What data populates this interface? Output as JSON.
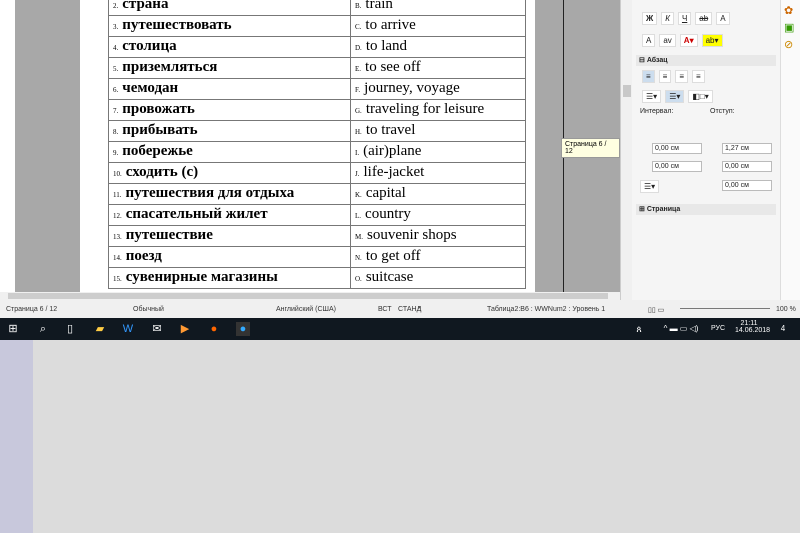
{
  "table": {
    "rows": [
      {
        "num": "2.",
        "ru": "страна",
        "letter": "B.",
        "en": "train"
      },
      {
        "num": "3.",
        "ru": "путешествовать",
        "letter": "C.",
        "en": "to arrive"
      },
      {
        "num": "4.",
        "ru": "столица",
        "letter": "D.",
        "en": "to land"
      },
      {
        "num": "5.",
        "ru": "приземляться",
        "letter": "E.",
        "en": "to see off"
      },
      {
        "num": "6.",
        "ru": "чемодан",
        "letter": "F.",
        "en": "journey, voyage"
      },
      {
        "num": "7.",
        "ru": "провожать",
        "letter": "G.",
        "en": "traveling for leisure"
      },
      {
        "num": "8.",
        "ru": "прибывать",
        "letter": "H.",
        "en": "to travel"
      },
      {
        "num": "9.",
        "ru": "побережье",
        "letter": "I.",
        "en": "(air)plane"
      },
      {
        "num": "10.",
        "ru": "сходить (с)",
        "letter": "J.",
        "en": "life-jacket"
      },
      {
        "num": "11.",
        "ru": "путешествия для отдыха",
        "letter": "K.",
        "en": "capital"
      },
      {
        "num": "12.",
        "ru": "спасательный жилет",
        "letter": "L.",
        "en": "country"
      },
      {
        "num": "13.",
        "ru": "путешествие",
        "letter": "M.",
        "en": "souvenir shops"
      },
      {
        "num": "14.",
        "ru": "поезд",
        "letter": "N.",
        "en": "to get off"
      },
      {
        "num": "15.",
        "ru": "сувенирные магазины",
        "letter": "O.",
        "en": "suitcase"
      }
    ]
  },
  "tooltip": "Страница 6 / 12",
  "sidebar": {
    "format": {
      "bold": "Ж",
      "italic": "К",
      "underline": "Ч"
    },
    "paragraph_title": "Абзац",
    "spacing_label": "Интервал:",
    "indent_label": "Отступ:",
    "above": "0,00 см",
    "below": "0,00 см",
    "before_text": "1,27 см",
    "after_text": "0,00 см",
    "first_line": "0,00 см",
    "page_title": "Страница"
  },
  "status": {
    "page": "Страница 6 / 12",
    "style": "Обычный",
    "language": "Английский (США)",
    "insert": "ВСТ",
    "selection": "СТАНД",
    "modified": "*",
    "cell": "Таблица2:B6 : WWNum2 : Уровень 1",
    "zoom": "100 %"
  },
  "taskbar": {
    "lang": "РУС",
    "time": "21:11",
    "date": "14.06.2018",
    "notif": "4"
  }
}
